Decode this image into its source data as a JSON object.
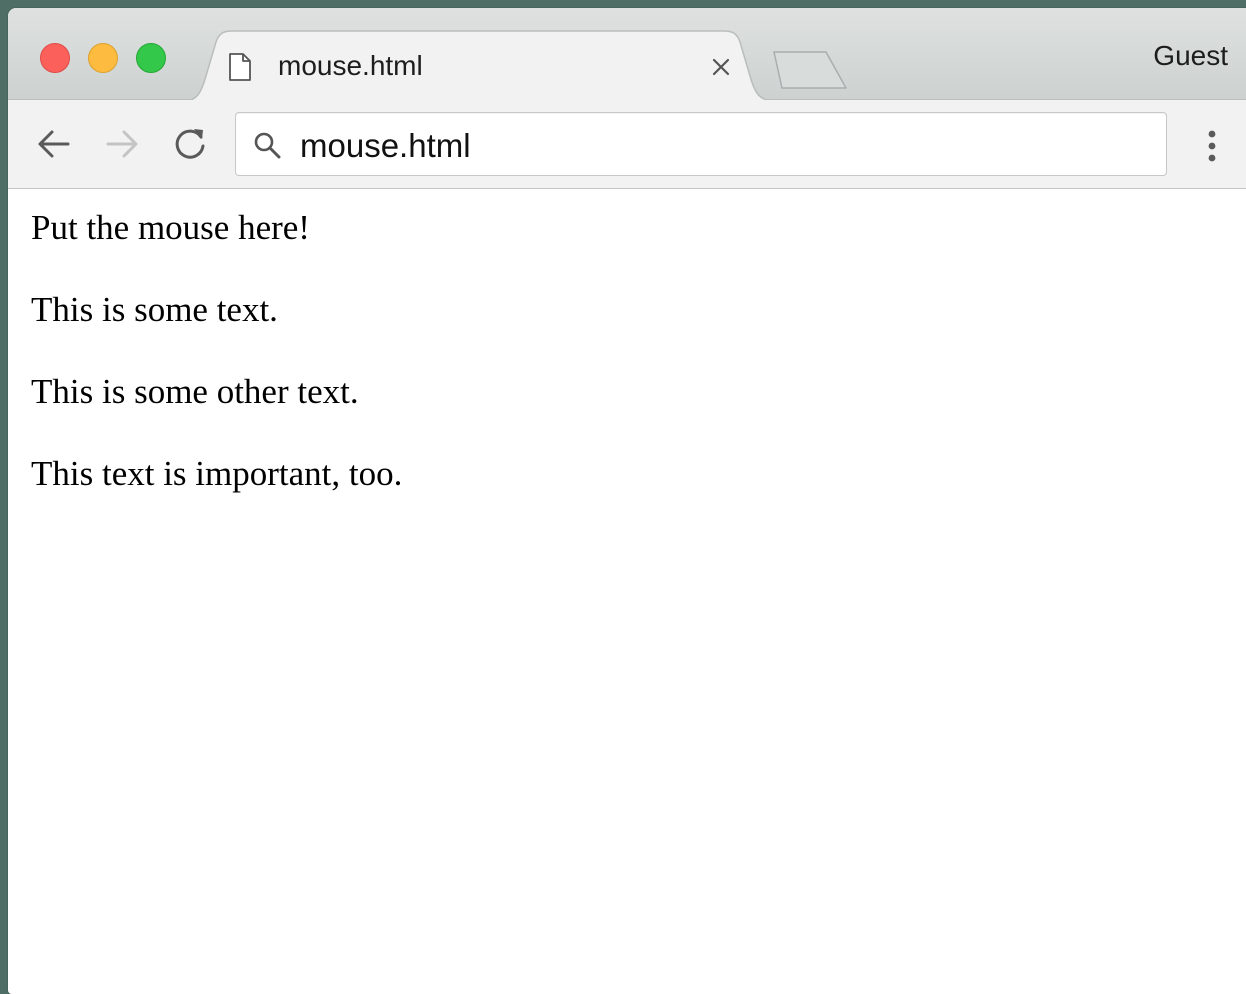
{
  "window": {
    "traffic_lights": {
      "close_color": "#fc605b",
      "minimize_color": "#fdbc40",
      "zoom_color": "#34c84a"
    }
  },
  "tab": {
    "title": "mouse.html",
    "icon": "document-icon"
  },
  "profile": {
    "label": "Guest"
  },
  "toolbar": {
    "back_icon": "back-arrow-icon",
    "forward_icon": "forward-arrow-icon",
    "reload_icon": "reload-icon",
    "address": "mouse.html",
    "menu_icon": "vertical-dots-icon"
  },
  "page": {
    "paragraphs": [
      "Put the mouse here!",
      "This is some text.",
      "This is some other text.",
      "This text is important, too."
    ]
  }
}
